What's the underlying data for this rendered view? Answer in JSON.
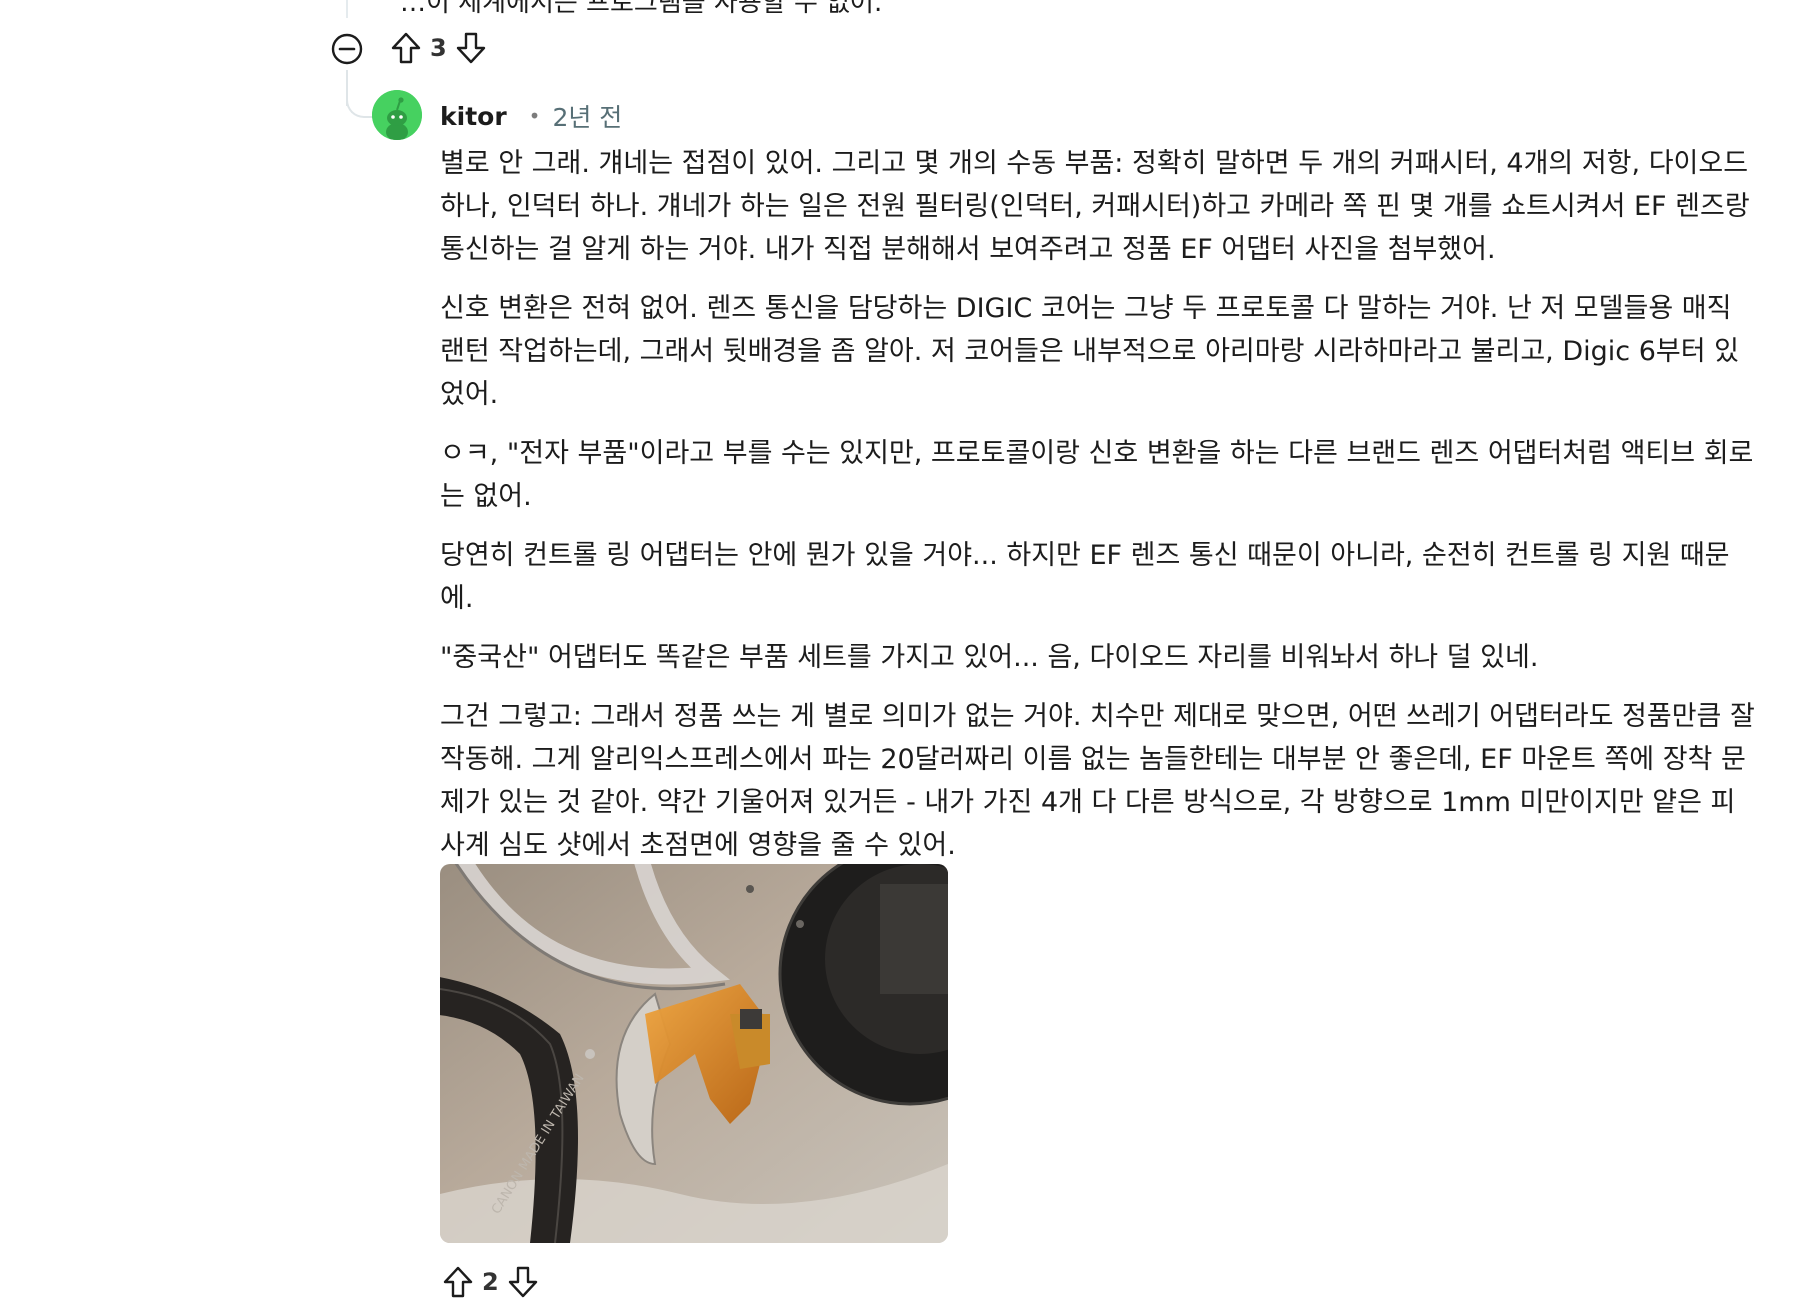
{
  "previous_comment": {
    "text_fragment": "…이 세계에서는 프로그램을 사용할 수 없어.",
    "vote_count": "3"
  },
  "comment": {
    "author": "kitor",
    "separator": "•",
    "time": "2년 전",
    "paragraphs": [
      "별로 안 그래. 걔네는 접점이 있어. 그리고 몇 개의 수동 부품: 정확히 말하면 두 개의 커패시터, 4개의 저항, 다이오드 하나, 인덕터 하나. 걔네가 하는 일은 전원 필터링(인덕터, 커패시터)하고 카메라 쪽 핀 몇 개를 쇼트시켜서 EF 렌즈랑 통신하는 걸 알게 하는 거야. 내가 직접 분해해서 보여주려고 정품 EF 어댑터 사진을 첨부했어.",
      "신호 변환은 전혀 없어. 렌즈 통신을 담당하는 DIGIC 코어는 그냥 두 프로토콜 다 말하는 거야. 난 저 모델들용 매직랜턴 작업하는데, 그래서 뒷배경을 좀 알아. 저 코어들은 내부적으로 아리마랑 시라하마라고 불리고, Digic 6부터 있었어.",
      "ㅇㅋ, \"전자 부품\"이라고 부를 수는 있지만, 프로토콜이랑 신호 변환을 하는 다른 브랜드 렌즈 어댑터처럼 액티브 회로는 없어.",
      "당연히 컨트롤 링 어댑터는 안에 뭔가 있을 거야... 하지만 EF 렌즈 통신 때문이 아니라, 순전히 컨트롤 링 지원 때문에.",
      "\"중국산\" 어댑터도 똑같은 부품 세트를 가지고 있어... 음, 다이오드 자리를 비워놔서 하나 덜 있네.",
      "그건 그렇고: 그래서 정품 쓰는 게 별로 의미가 없는 거야. 치수만 제대로 맞으면, 어떤 쓰레기 어댑터라도 정품만큼 잘 작동해. 그게 알리익스프레스에서 파는 20달러짜리 이름 없는 놈들한테는 대부분 안 좋은데, EF 마운트 쪽에 장착 문제가 있는 것 같아. 약간 기울어져 있거든 - 내가 가진 4개 다 다른 방식으로, 각 방향으로 1mm 미만이지만 얕은 피사계 심도 샷에서 초점면에 영향을 줄 수 있어."
    ],
    "image": {
      "ring_text": "CANON MADE IN TAIWAN"
    },
    "vote_count": "2"
  },
  "icons": {
    "upvote": "arrow-up-outline-icon",
    "downvote": "arrow-down-outline-icon",
    "collapse": "minus-circle-icon",
    "avatar": "snoo-avatar-icon"
  },
  "colors": {
    "avatar_bg": "#46d160",
    "thread_line": "#e5ebee",
    "meta_text": "#576f76"
  }
}
